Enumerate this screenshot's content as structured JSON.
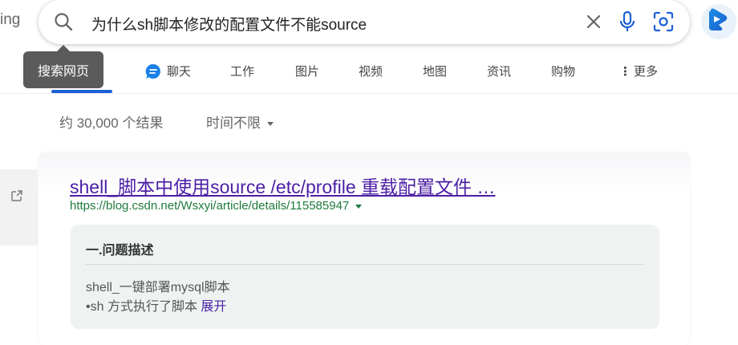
{
  "brand_fragment": "ing",
  "search": {
    "query": "为什么sh脚本修改的配置文件不能source"
  },
  "tooltip": {
    "text": "搜索网页"
  },
  "nav": {
    "items": [
      {
        "label": "聊天"
      },
      {
        "label": "工作"
      },
      {
        "label": "图片"
      },
      {
        "label": "视频"
      },
      {
        "label": "地图"
      },
      {
        "label": "资讯"
      },
      {
        "label": "购物"
      },
      {
        "label": "更多"
      }
    ]
  },
  "results_info": {
    "count": "约 30,000 个结果",
    "time_filter": "时间不限"
  },
  "result": {
    "title": "shell_脚本中使用source /etc/profile 重载配置文件 …",
    "url": "https://blog.csdn.net/Wsxyi/article/details/115585947",
    "snippet": {
      "heading": "一.问题描述",
      "line1": "shell_一键部署mysql脚本",
      "line2": "•sh 方式执行了脚本",
      "expand": "展开"
    }
  },
  "colors": {
    "accent": "#1a5fd6",
    "title_link": "#4c1ea6",
    "url_green": "#1e7a3c",
    "tooltip_bg": "#5b5b5b",
    "snippet_bg": "#eef3f2"
  },
  "icons": [
    "search-icon",
    "clear-icon",
    "microphone-icon",
    "visual-search-icon",
    "copilot-icon",
    "chat-bubble-icon",
    "more-dots-icon",
    "open-external-icon",
    "dropdown-caret-icon"
  ]
}
